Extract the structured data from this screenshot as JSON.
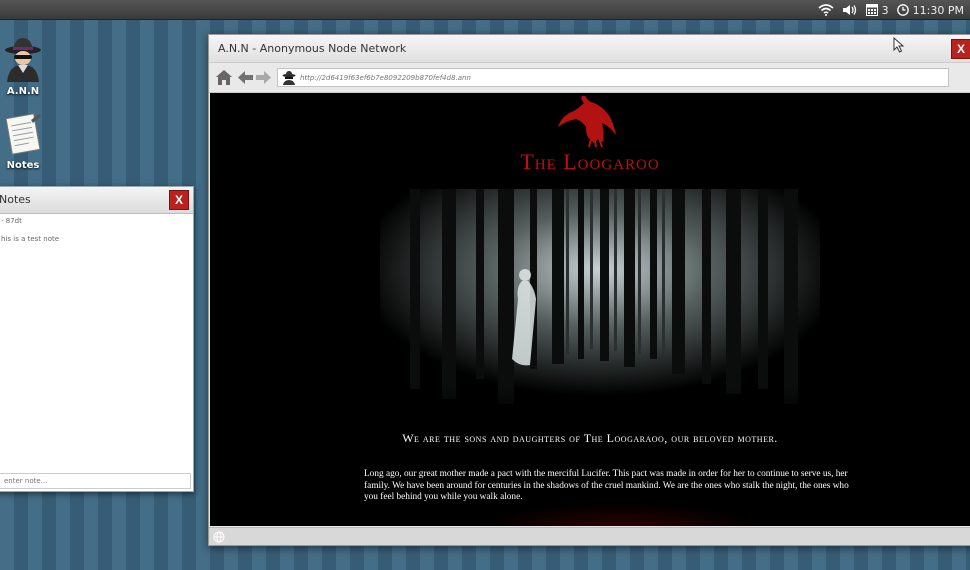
{
  "top_panel": {
    "mail_count": "3",
    "clock": "11:30 PM",
    "icons": [
      "wifi-icon",
      "volume-icon",
      "calendar-icon",
      "clock-icon"
    ]
  },
  "desktop": {
    "icons": [
      {
        "label": "A.N.N",
        "icon": "spy-icon"
      },
      {
        "label": "Notes",
        "icon": "notepad-icon"
      }
    ]
  },
  "notes_window": {
    "title": "Notes",
    "close_label": "X",
    "note_meta": "- 87dt",
    "note_body": "his is a test note",
    "input_placeholder": "enter note..."
  },
  "browser": {
    "title": "A.N.N - Anonymous Node Network",
    "close_label": "X",
    "url": "http://2d6419f63ef6b7e8092209b870fef4d8.ann",
    "nav": [
      "home-icon",
      "back-arrow-icon",
      "forward-arrow-icon"
    ]
  },
  "site": {
    "title": "The Loogaroo",
    "tagline": "We are the sons and daughters of The Loogaraoo, our beloved mother.",
    "story": "Long ago, our great mother made a pact with the merciful Lucifer. This pact was made in order for her to continue to serve us, her family.  We have been around for centuries in the shadows of the cruel mankind. We are the ones who stalk the night, the ones who you feel behind you while you walk alone.",
    "accent_color": "#c01010"
  }
}
